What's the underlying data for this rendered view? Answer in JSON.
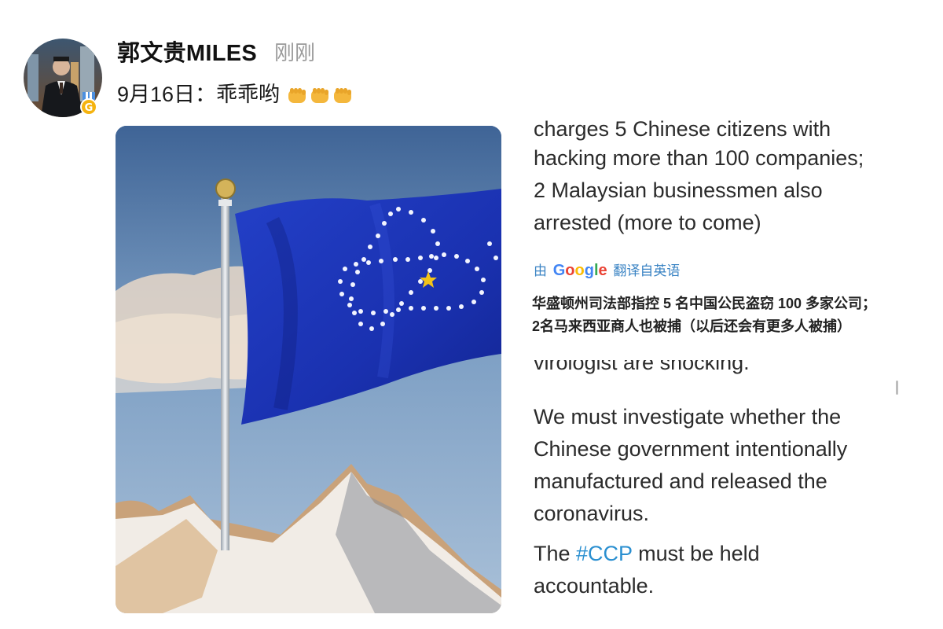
{
  "post": {
    "author": "郭文贵MILES",
    "time": "刚刚",
    "text": "9月16日：乖乖哟"
  },
  "tweet_top": {
    "clipped_line": "charges 5 Chinese citizens with",
    "lines": [
      "hacking more than 100 companies;",
      "2 Malaysian businessmen also",
      "arrested (more to come)"
    ]
  },
  "translation": {
    "prefix": "由",
    "brand": "Google",
    "suffix": "翻译自英语",
    "text": "华盛顿州司法部指控 5 名中国公民盗窃 100 多家公司； 2名马来西亚商人也被捕（以后还会有更多人被捕）"
  },
  "tweet_bottom": {
    "clipped_line": "virologist are shocking.",
    "para1": [
      "We must investigate whether the",
      "Chinese government intentionally",
      "manufactured and released the",
      "coronavirus."
    ],
    "para2_start": "The ",
    "hashtag": "#CCP",
    "para2_end": " must be held",
    "para2_line2": "accountable."
  },
  "colors": {
    "accent_link": "#2a8fd0",
    "muted_text": "#9a9a9a",
    "flag_blue": "#1d36b8",
    "star_gold": "#f2c319"
  },
  "icons": {
    "badge": "verified-medal-icon",
    "emoji": "oncoming-fist-emoji"
  }
}
